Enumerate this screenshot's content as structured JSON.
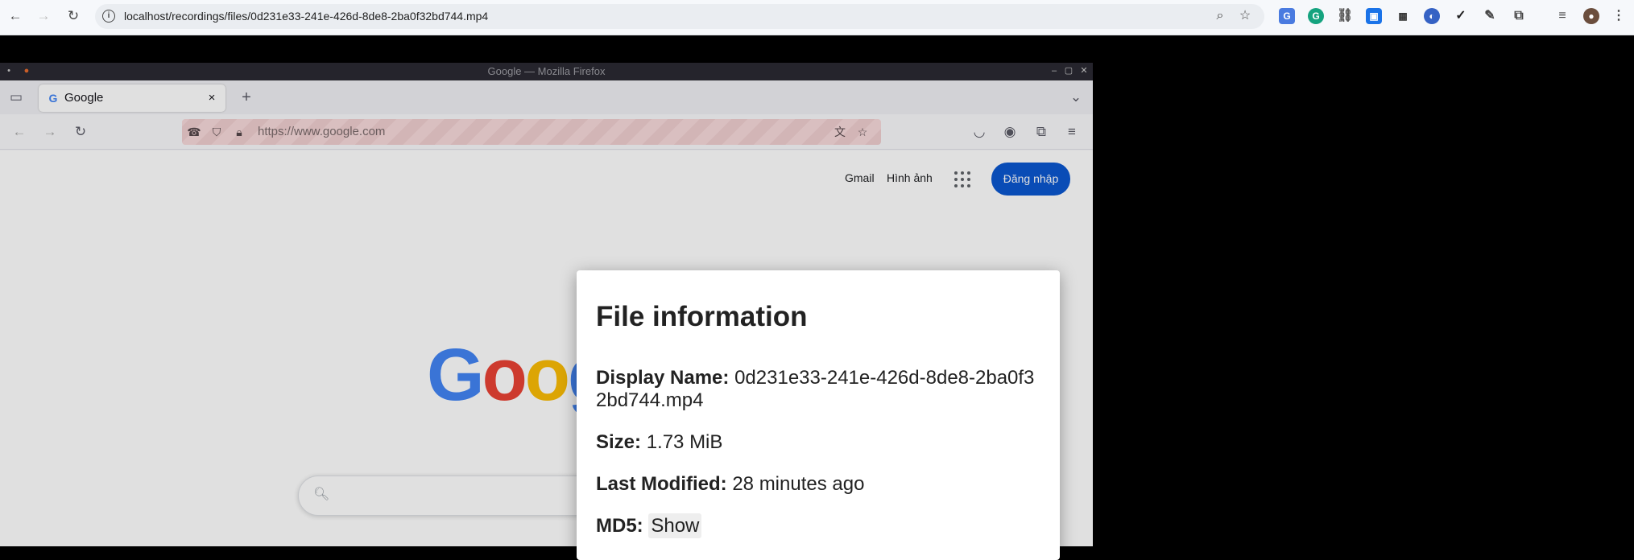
{
  "chrome": {
    "url": "localhost/recordings/files/0d231e33-241e-426d-8de8-2ba0f32bd744.mp4"
  },
  "firefox": {
    "window_title": "Google — Mozilla Firefox",
    "tab_title": "Google",
    "url": "https://www.google.com"
  },
  "google": {
    "gmail": "Gmail",
    "images": "Hình ảnh",
    "signin": "Đăng nhập",
    "logo_visible": "Goog"
  },
  "modal": {
    "title": "File information",
    "display_name_label": "Display Name:",
    "display_name_value": "0d231e33-241e-426d-8de8-2ba0f32bd744.mp4",
    "size_label": "Size:",
    "size_value": "1.73 MiB",
    "last_modified_label": "Last Modified:",
    "last_modified_value": "28 minutes ago",
    "md5_label": "MD5:",
    "md5_show": "Show"
  },
  "colors": {
    "accent": "#0b57d0",
    "g_blue": "#4285f4",
    "g_red": "#ea4335",
    "g_yellow": "#fbbc05",
    "g_green": "#34a853"
  }
}
